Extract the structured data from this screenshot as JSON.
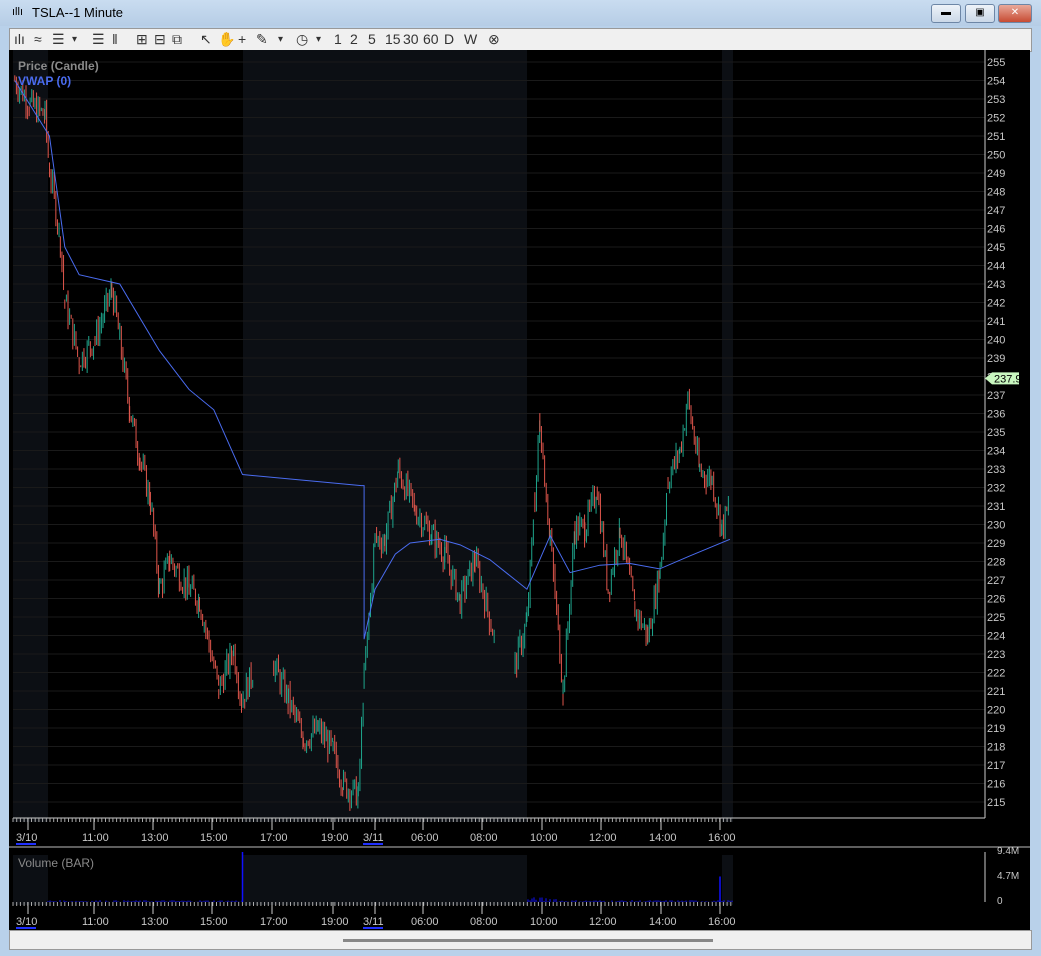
{
  "window": {
    "title": "TSLA--1 Minute",
    "buttons": [
      "minimize",
      "maximize",
      "close"
    ]
  },
  "toolbar": {
    "items": [
      "chart-type-icon",
      "line-icon",
      "layers-icon",
      "▾",
      "hlines-icon",
      "vlines-icon",
      "zoom-in-icon",
      "zoom-out-icon",
      "fit-icon",
      "pointer-icon",
      "hand-icon",
      "crosshair-icon",
      "pencil-icon",
      "▾",
      "clock-icon",
      "▾",
      "1",
      "2",
      "5",
      "15",
      "30",
      "60",
      "D",
      "W",
      "cancel-icon"
    ]
  },
  "price_panel": {
    "label": "Price (Candle)",
    "vwap_label": "VWAP (0)",
    "last_price": "237.9",
    "y_ticks": [
      255,
      254,
      253,
      252,
      251,
      250,
      249,
      248,
      247,
      246,
      245,
      244,
      243,
      242,
      241,
      240,
      239,
      238,
      237,
      236,
      235,
      234,
      233,
      232,
      231,
      230,
      229,
      228,
      227,
      226,
      225,
      224,
      223,
      222,
      221,
      220,
      219,
      218,
      217,
      216,
      215
    ]
  },
  "volume_panel": {
    "label": "Volume (BAR)",
    "y_ticks": [
      "9.4M",
      "4.7M",
      "0"
    ]
  },
  "x_ticks": [
    "3/10",
    "11:00",
    "13:00",
    "15:00",
    "17:00",
    "19:00",
    "3/11",
    "06:00",
    "08:00",
    "10:00",
    "12:00",
    "14:00",
    "16:00"
  ],
  "colors": {
    "up": "#1ea58c",
    "down": "#e0564c",
    "vwap": "#4a6cf0",
    "volume": "#1010ff",
    "extended_shade": "#0c0f14"
  },
  "chart_data": {
    "type": "candlestick",
    "symbol": "TSLA",
    "interval": "1 Minute",
    "ylim": [
      215,
      255
    ],
    "price": [
      [
        "3/10",
        "08:20",
        254.0
      ],
      [
        "3/10",
        "08:51",
        252.7
      ],
      [
        "3/10",
        "09:21",
        252.1
      ],
      [
        "3/10",
        "09:30",
        249.2
      ],
      [
        "3/10",
        "09:52",
        245.4
      ],
      [
        "3/10",
        "10:01",
        242.1
      ],
      [
        "3/10",
        "10:30",
        238.9
      ],
      [
        "3/10",
        "11:02",
        240.0
      ],
      [
        "3/10",
        "11:36",
        242.7
      ],
      [
        "3/10",
        "11:52",
        240.0
      ],
      [
        "3/10",
        "12:12",
        236.2
      ],
      [
        "3/10",
        "12:33",
        233.5
      ],
      [
        "3/10",
        "12:54",
        231.3
      ],
      [
        "3/10",
        "13:12",
        226.5
      ],
      [
        "3/10",
        "13:33",
        228.1
      ],
      [
        "3/10",
        "14:12",
        226.5
      ],
      [
        "3/10",
        "14:33",
        225.9
      ],
      [
        "3/10",
        "15:12",
        221.1
      ],
      [
        "3/10",
        "15:42",
        223.2
      ],
      [
        "3/10",
        "15:58",
        220.5
      ],
      [
        "3/10",
        "16:22",
        222.1
      ],
      [
        "3/10",
        "17:03",
        222.4
      ],
      [
        "3/10",
        "17:33",
        220.5
      ],
      [
        "3/10",
        "18:03",
        218.4
      ],
      [
        "3/10",
        "18:33",
        218.9
      ],
      [
        "3/10",
        "19:03",
        217.8
      ],
      [
        "3/10",
        "19:24",
        215.9
      ],
      [
        "3/10",
        "19:54",
        215.4
      ],
      [
        "3/11",
        "04:01",
        221.6
      ],
      [
        "3/11",
        "04:23",
        229.2
      ],
      [
        "3/11",
        "04:43",
        229.2
      ],
      [
        "3/11",
        "05:10",
        232.9
      ],
      [
        "3/11",
        "05:44",
        230.8
      ],
      [
        "3/11",
        "06:18",
        229.4
      ],
      [
        "3/11",
        "06:44",
        228.4
      ],
      [
        "3/11",
        "07:15",
        225.9
      ],
      [
        "3/11",
        "07:45",
        228.1
      ],
      [
        "3/11",
        "08:25",
        223.8
      ],
      [
        "3/11",
        "09:06",
        222.4
      ],
      [
        "3/11",
        "09:30",
        224.8
      ],
      [
        "3/11",
        "09:46",
        231.3
      ],
      [
        "3/11",
        "09:56",
        235.6
      ],
      [
        "3/11",
        "10:17",
        229.2
      ],
      [
        "3/11",
        "10:43",
        221.1
      ],
      [
        "3/11",
        "11:07",
        229.8
      ],
      [
        "3/11",
        "11:27",
        229.8
      ],
      [
        "3/11",
        "11:52",
        231.9
      ],
      [
        "3/11",
        "12:14",
        226.5
      ],
      [
        "3/11",
        "12:38",
        229.8
      ],
      [
        "3/11",
        "13:08",
        225.4
      ],
      [
        "3/11",
        "13:34",
        224.0
      ],
      [
        "3/11",
        "13:59",
        227.5
      ],
      [
        "3/11",
        "14:15",
        232.4
      ],
      [
        "3/11",
        "14:39",
        234.0
      ],
      [
        "3/11",
        "14:55",
        236.7
      ],
      [
        "3/11",
        "15:19",
        232.9
      ],
      [
        "3/11",
        "15:44",
        232.4
      ],
      [
        "3/11",
        "16:04",
        229.8
      ],
      [
        "3/11",
        "16:20",
        231.1
      ]
    ],
    "vwap": [
      [
        "3/10",
        "08:20",
        254.0
      ],
      [
        "3/10",
        "09:30",
        251.0
      ],
      [
        "3/10",
        "10:01",
        245.0
      ],
      [
        "3/10",
        "10:30",
        243.5
      ],
      [
        "3/10",
        "11:52",
        243.0
      ],
      [
        "3/10",
        "13:12",
        239.4
      ],
      [
        "3/10",
        "14:12",
        237.3
      ],
      [
        "3/10",
        "15:02",
        236.2
      ],
      [
        "3/10",
        "16:00",
        232.7
      ],
      [
        "3/10",
        "20:00",
        232.1
      ],
      [
        "3/11",
        "04:01",
        223.8
      ],
      [
        "3/11",
        "04:23",
        226.5
      ],
      [
        "3/11",
        "05:04",
        228.4
      ],
      [
        "3/11",
        "05:34",
        229.0
      ],
      [
        "3/11",
        "06:34",
        229.2
      ],
      [
        "3/11",
        "07:15",
        228.9
      ],
      [
        "3/11",
        "08:15",
        228.1
      ],
      [
        "3/11",
        "09:30",
        226.5
      ],
      [
        "3/11",
        "10:17",
        229.4
      ],
      [
        "3/11",
        "10:57",
        227.4
      ],
      [
        "3/11",
        "11:57",
        227.8
      ],
      [
        "3/11",
        "12:57",
        227.9
      ],
      [
        "3/11",
        "13:58",
        227.6
      ],
      [
        "3/11",
        "14:59",
        228.3
      ],
      [
        "3/11",
        "16:20",
        229.2
      ]
    ],
    "volume_ylim": [
      0,
      9.4
    ],
    "volume_spikes": [
      [
        "3/10",
        "16:00",
        9.4
      ],
      [
        "3/11",
        "16:00",
        4.8
      ]
    ]
  }
}
